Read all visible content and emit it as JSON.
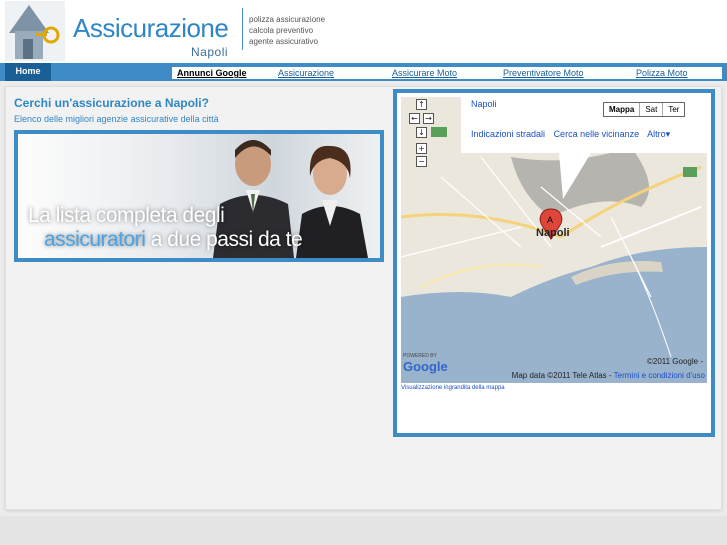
{
  "header": {
    "logo_title": "Assicurazione",
    "logo_subtitle": "Napoli",
    "links": [
      "polizza assicurazione",
      "calcola preventivo",
      "agente assicurativo"
    ]
  },
  "nav": {
    "home": "Home",
    "links": [
      "Annunci Google",
      "Assicurazione",
      "Assicurare Moto",
      "Preventivatore Moto",
      "Polizza Moto"
    ]
  },
  "main": {
    "headline": "Cerchi un'assicurazione a Napoli?",
    "subheadline": "Elenco delle migliori agenzie assicurative della città",
    "banner": {
      "line1": "La lista completa degli",
      "line2_highlight": "assicuratori",
      "line2_rest": " a due passi da te"
    }
  },
  "map": {
    "place": "Napoli",
    "links": [
      "Indicazioni stradali",
      "Cerca nelle vicinanze",
      "Altro▾"
    ],
    "map_types": [
      "Mappa",
      "Sat",
      "Ter"
    ],
    "pin_letter": "A",
    "pin_label": "Napoli",
    "copyright": "©2011 Google -",
    "map_data": "Map data ©2011 Tele Atlas -",
    "terms": "Termini e condizioni d'uso",
    "powered_by": "POWERED BY",
    "google_logo": "Google",
    "larger_map_link": "Visualizzazione ingrandita della mappa",
    "zoom_controls": [
      "↑",
      "←",
      "→",
      "↓",
      "+",
      "−"
    ]
  },
  "colors": {
    "brand_blue": "#3f8bc5",
    "text_blue": "#2f86c6",
    "dark_blue": "#1a5f95"
  }
}
